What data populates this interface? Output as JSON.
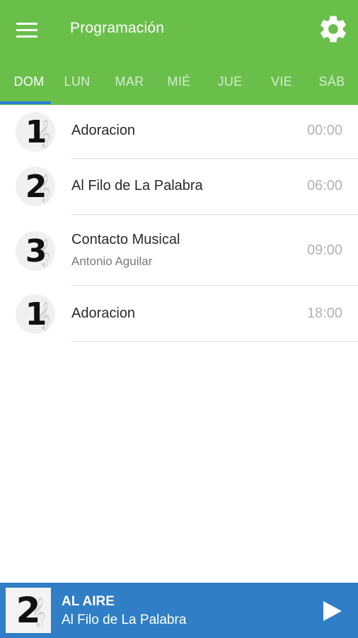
{
  "header": {
    "title": "Programación",
    "menu_icon": "menu-icon",
    "settings_icon": "gear-icon",
    "background_color": "#6abf4b"
  },
  "tabs": [
    {
      "label": "DOM",
      "active": true
    },
    {
      "label": "LUN",
      "active": false
    },
    {
      "label": "MAR",
      "active": false
    },
    {
      "label": "MIÉ",
      "active": false
    },
    {
      "label": "JUE",
      "active": false
    },
    {
      "label": "VIE",
      "active": false
    },
    {
      "label": "SÁB",
      "active": false
    }
  ],
  "schedule": [
    {
      "badge": "1",
      "name": "Adoracion",
      "host": "",
      "time": "00:00"
    },
    {
      "badge": "2",
      "name": "Al Filo de La Palabra",
      "host": "",
      "time": "06:00"
    },
    {
      "badge": "3",
      "name": "Contacto Musical",
      "host": "Antonio Aguilar",
      "time": "09:00"
    },
    {
      "badge": "1",
      "name": "Adoracion",
      "host": "",
      "time": "18:00"
    }
  ],
  "player": {
    "badge": "2",
    "status": "AL AIRE",
    "now_playing": "Al Filo de La Palabra",
    "play_icon": "play-icon",
    "background_color": "#2f7ec6"
  },
  "accent_color": "#2a7fd4"
}
